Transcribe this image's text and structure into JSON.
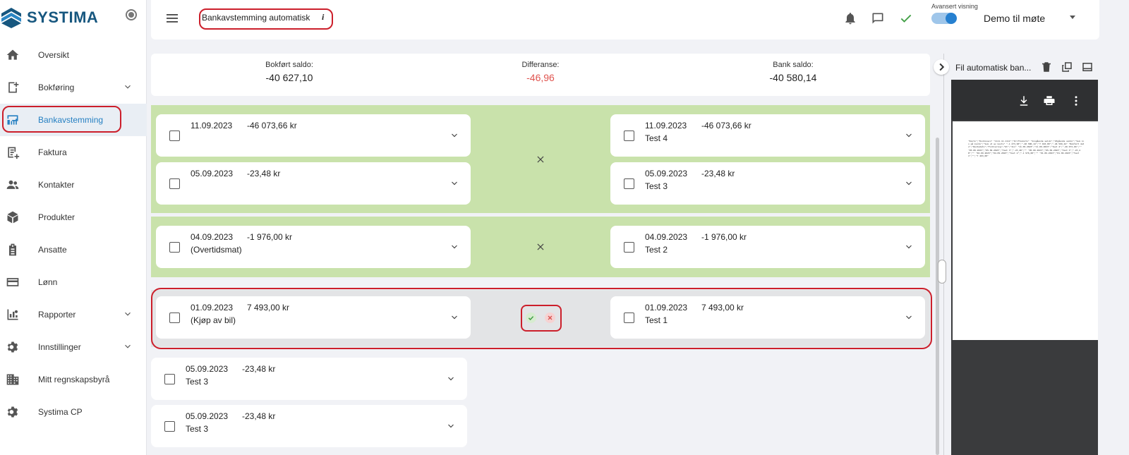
{
  "app": {
    "logo_text": "SYSTIMA"
  },
  "sidebar": {
    "items": [
      {
        "label": "Oversikt",
        "icon": "home-icon"
      },
      {
        "label": "Bokføring",
        "icon": "ledger-icon",
        "expandable": true
      },
      {
        "label": "Bankavstemming",
        "icon": "bank-reconcile-icon",
        "active": true
      },
      {
        "label": "Faktura",
        "icon": "invoice-icon"
      },
      {
        "label": "Kontakter",
        "icon": "contacts-icon"
      },
      {
        "label": "Produkter",
        "icon": "box-icon"
      },
      {
        "label": "Ansatte",
        "icon": "badge-icon"
      },
      {
        "label": "Lønn",
        "icon": "card-icon"
      },
      {
        "label": "Rapporter",
        "icon": "reports-icon",
        "expandable": true
      },
      {
        "label": "Innstillinger",
        "icon": "gear-icon",
        "expandable": true
      },
      {
        "label": "Mitt regnskapsbyrå",
        "icon": "office-icon"
      },
      {
        "label": "Systima CP",
        "icon": "gear-icon"
      }
    ]
  },
  "header": {
    "title": "Bankavstemming automatisk",
    "info": "i",
    "advanced_label": "Avansert visning",
    "advanced_on": true,
    "company": "Demo til møte"
  },
  "summary": {
    "booked_label": "Bokført saldo:",
    "booked_value": "-40 627,10",
    "diff_label": "Differanse:",
    "diff_value": "-46,96",
    "bank_label": "Bank saldo:",
    "bank_value": "-40 580,14"
  },
  "matches": {
    "g1": {
      "left": [
        {
          "date": "11.09.2023",
          "amount": "-46 073,66 kr",
          "desc": ""
        },
        {
          "date": "05.09.2023",
          "amount": "-23,48 kr",
          "desc": ""
        }
      ],
      "right": [
        {
          "date": "11.09.2023",
          "amount": "-46 073,66 kr",
          "desc": "Test 4"
        },
        {
          "date": "05.09.2023",
          "amount": "-23,48 kr",
          "desc": "Test 3"
        }
      ]
    },
    "g2": {
      "left": {
        "date": "04.09.2023",
        "amount": "-1 976,00 kr",
        "desc": "(Overtidsmat)"
      },
      "right": {
        "date": "04.09.2023",
        "amount": "-1 976,00 kr",
        "desc": "Test 2"
      }
    },
    "g3": {
      "left": {
        "date": "01.09.2023",
        "amount": "7 493,00 kr",
        "desc": "(Kjøp av bil)"
      },
      "right": {
        "date": "01.09.2023",
        "amount": "7 493,00 kr",
        "desc": "Test 1"
      }
    }
  },
  "unmatched": [
    {
      "date": "05.09.2023",
      "amount": "-23,48 kr",
      "desc": "Test 3"
    },
    {
      "date": "05.09.2023",
      "amount": "-23,48 kr",
      "desc": "Test 3"
    }
  ],
  "file_panel": {
    "title": "Fil automatisk ban...",
    "pdf_text": "\"Konto\";\"Kontonavn\" \"1111.11.1111\";\"Driftskonto\" \"Inngående saldo\";\"Utgående saldo\";\"Sum inn på konto\";\"Sum ut av konto\" \"-1 473,90\";\"-40 580,14\";\"7 493,00\";\"-46 599,24\" \"Bokført dato\";\"Rentedato\";\"Forklaring\";\"Ut\";\"Inn\" \"11.09.2023\";\"11.09.2023\";\"Test 4\";\"-46 073,66\";\"\" \"05.09.2023\";\"05.09.2023\";\"Test 3\";\"-23,48\";\"\" \"05.09.2023\";\"05.09.2023\";\"Test 3\";\"-23,48\";\"\" \"04.09.2023\";\"04.09.2023\";\"Test 2\";\"-1 976,00\";\"\" \"01.09.2023\";\"01.09.2023\";\"Test 1\";\"\";\"7 493,00\""
  },
  "colors": {
    "accent": "#2680c2",
    "matched_bg": "#c9e2ab",
    "pending_bg": "#e3e4e6",
    "negative": "#e0544f",
    "highlight": "#cc1f2b"
  }
}
